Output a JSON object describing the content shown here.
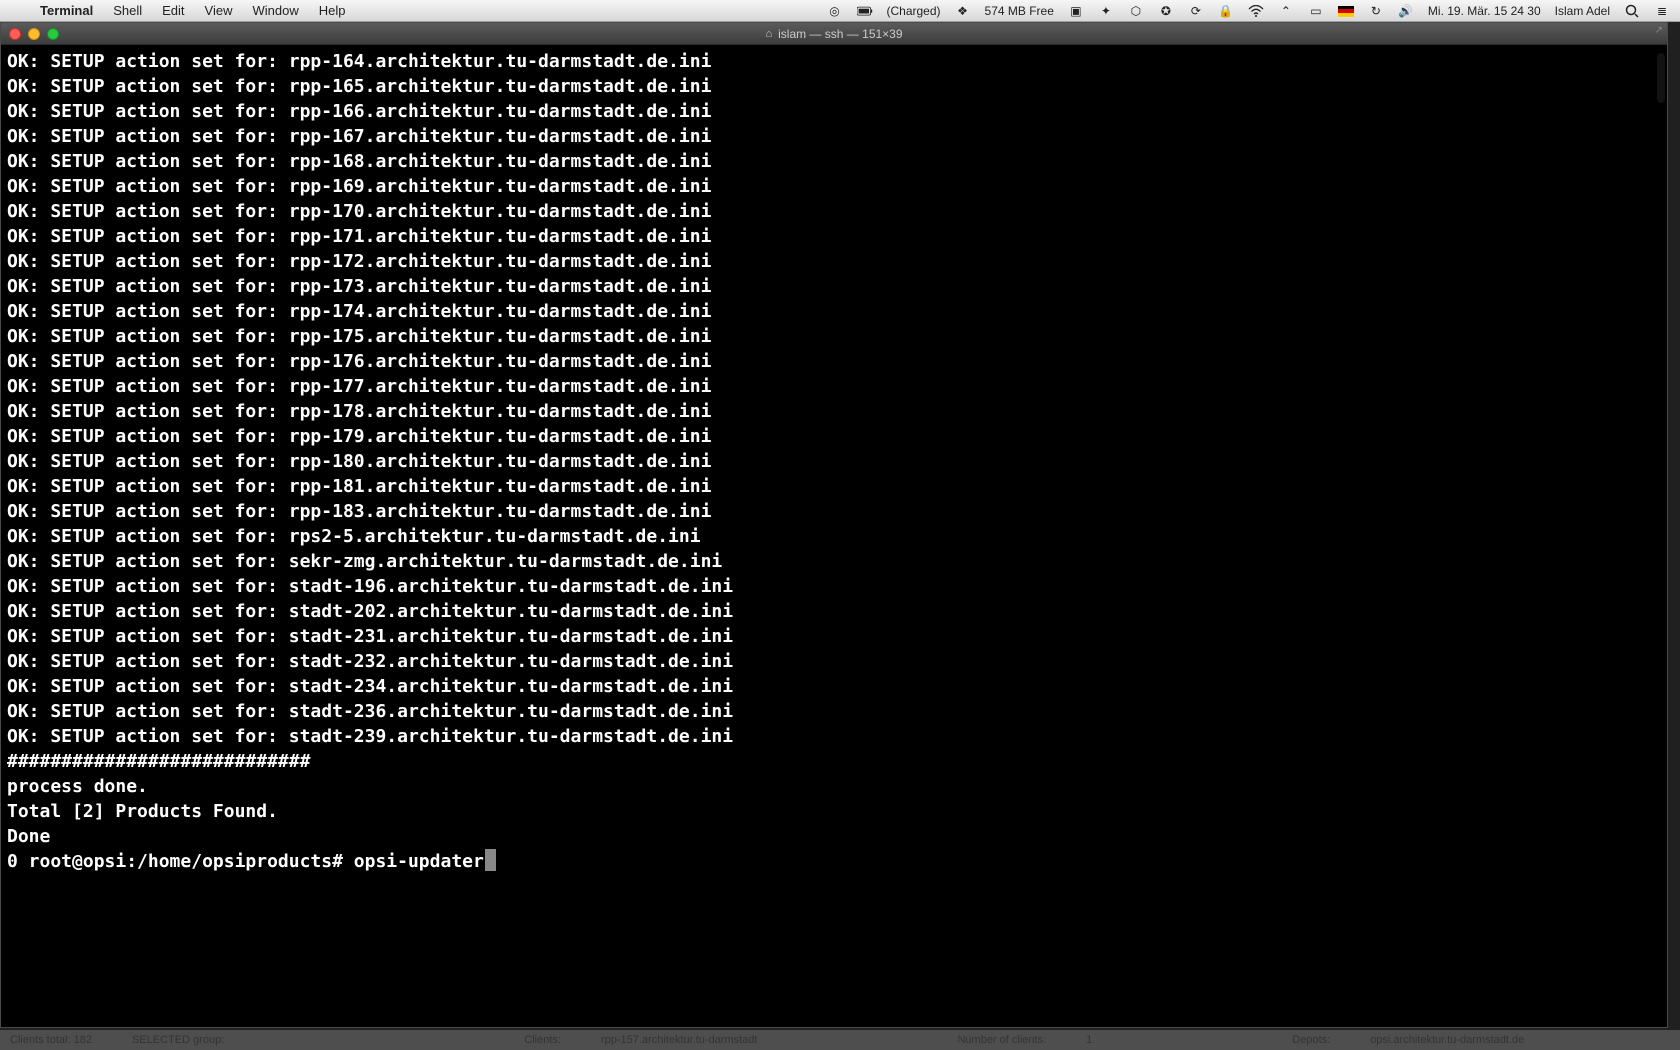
{
  "menubar": {
    "app_name": "Terminal",
    "items": [
      "Shell",
      "Edit",
      "View",
      "Window",
      "Help"
    ],
    "battery_text": "(Charged)",
    "mem_text": "574 MB Free",
    "date_text": "Mi. 19. Mär.  15 24 30",
    "user_text": "Islam Adel"
  },
  "terminal": {
    "title_prefix": "islam — ssh — 151×39",
    "prompt_prefix": "0 root@opsi:/home/opsiproducts# ",
    "prompt_cmd": "opsi-updater",
    "post_lines": [
      "",
      "############################",
      "",
      "process done.",
      "",
      "",
      "",
      "Total [2] Products Found.",
      "",
      "Done"
    ],
    "setup_hosts": [
      "rpp-164.architektur.tu-darmstadt.de.ini",
      "rpp-165.architektur.tu-darmstadt.de.ini",
      "rpp-166.architektur.tu-darmstadt.de.ini",
      "rpp-167.architektur.tu-darmstadt.de.ini",
      "rpp-168.architektur.tu-darmstadt.de.ini",
      "rpp-169.architektur.tu-darmstadt.de.ini",
      "rpp-170.architektur.tu-darmstadt.de.ini",
      "rpp-171.architektur.tu-darmstadt.de.ini",
      "rpp-172.architektur.tu-darmstadt.de.ini",
      "rpp-173.architektur.tu-darmstadt.de.ini",
      "rpp-174.architektur.tu-darmstadt.de.ini",
      "rpp-175.architektur.tu-darmstadt.de.ini",
      "rpp-176.architektur.tu-darmstadt.de.ini",
      "rpp-177.architektur.tu-darmstadt.de.ini",
      "rpp-178.architektur.tu-darmstadt.de.ini",
      "rpp-179.architektur.tu-darmstadt.de.ini",
      "rpp-180.architektur.tu-darmstadt.de.ini",
      "rpp-181.architektur.tu-darmstadt.de.ini",
      "rpp-183.architektur.tu-darmstadt.de.ini",
      "rps2-5.architektur.tu-darmstadt.de.ini",
      "sekr-zmg.architektur.tu-darmstadt.de.ini",
      "stadt-196.architektur.tu-darmstadt.de.ini",
      "stadt-202.architektur.tu-darmstadt.de.ini",
      "stadt-231.architektur.tu-darmstadt.de.ini",
      "stadt-232.architektur.tu-darmstadt.de.ini",
      "stadt-234.architektur.tu-darmstadt.de.ini",
      "stadt-236.architektur.tu-darmstadt.de.ini",
      "stadt-239.architektur.tu-darmstadt.de.ini"
    ],
    "setup_prefix": "OK: SETUP action set for: "
  },
  "bottom_status": {
    "clients_total": "Clients total: 182",
    "selected": "SELECTED  group:",
    "clients_label": "Clients:",
    "client_value": "rpp-157.architektur.tu-darmstadt",
    "num_clients_label": "Number of clients:",
    "num_clients_value": "1",
    "depots_label": "Depots:",
    "depots_value": "opsi.architektur.tu-darmstadt.de"
  }
}
